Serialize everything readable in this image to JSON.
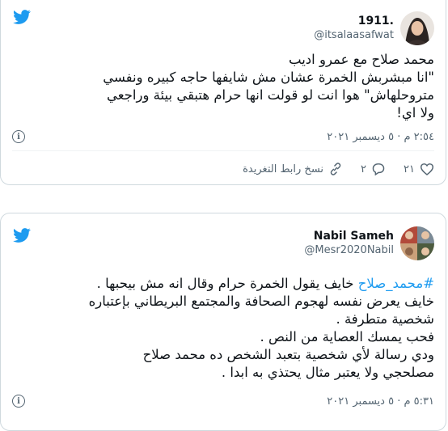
{
  "tweet1": {
    "display_name": "1911.",
    "handle": "@itsalaasafwat",
    "body_lines": [
      "محمد صلاح مع عمرو اديب",
      "\"انا مبشربش الخمرة عشان مش شايفها حاجه كبيره ونفسي",
      "متروحلهاش\" هوا انت لو قولت انها حرام هتبقي بيئة وراجعي",
      "ولا اي!"
    ],
    "timestamp": "٢:٥٤ م · ٥ ديسمبر ٢٠٢١",
    "actions": {
      "like_count": "٢١",
      "reply_count": "٢",
      "copy_link_label": "نسخ رابط التغريدة"
    }
  },
  "tweet2": {
    "display_name": "Nabil Sameh",
    "handle": "@Mesr2020Nabil",
    "hashtag": "#محمد_صلاح",
    "first_line_rest": " خايف يقول الخمرة حرام وقال انه مش بيحبها .",
    "body_lines": [
      "خايف يعرض نفسه لهجوم الصحافة والمجتمع البريطاني بإعتباره",
      "شخصية متطرفة .",
      "فحب يمسك العصاية من النص .",
      "ودي رسالة لأي شخصية بتعبد الشخص ده محمد صلاح",
      "مصلحجي ولا يعتبر مثال يحتذي به ابدا ."
    ],
    "timestamp": "٥:٣١ م · ٥ ديسمبر ٢٠٢١"
  },
  "colors": {
    "brand": "#1d9bf0",
    "secondary_text": "#536471",
    "border": "#cfd9de"
  },
  "icons": [
    "twitter-bird-icon",
    "info-icon",
    "heart-icon",
    "reply-icon",
    "link-icon"
  ]
}
